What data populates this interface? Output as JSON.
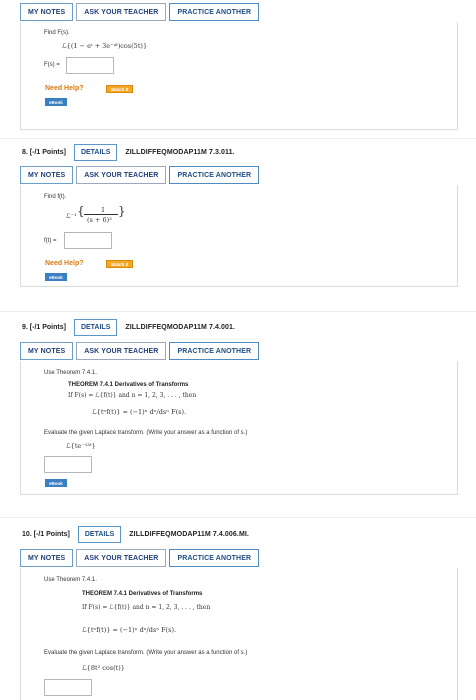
{
  "buttons": {
    "my_notes": "MY NOTES",
    "ask_teacher": "ASK YOUR TEACHER",
    "practice": "PRACTICE ANOTHER",
    "details": "DETAILS"
  },
  "help": {
    "need_help": "Need Help?",
    "watch": "Watch It",
    "ebook": "eBook"
  },
  "q7": {
    "instruction": "Find F(s).",
    "expression": "ℒ{(1 − eᵗ + 3e⁻⁴ᵗ)cos(5t)}",
    "answer_label": "F(s) ="
  },
  "q8": {
    "number": "8. [-/1 Points]",
    "id": "ZILLDIFFEQMODAP11M 7.3.011.",
    "instruction": "Find f(t).",
    "op": "ℒ⁻¹",
    "numerator": "1",
    "denominator": "(s + 6)³",
    "answer_label": "f(t) ="
  },
  "q9": {
    "number": "9. [-/1 Points]",
    "id": "ZILLDIFFEQMODAP11M 7.4.001.",
    "use": "Use Theorem 7.4.1.",
    "theorem_title": "THEOREM 7.4.1  Derivatives of Transforms",
    "theorem_line": "If F(s) = ℒ{f(t)} and n = 1, 2, 3, . . . , then",
    "formula": "ℒ{tⁿf(t)} = (−1)ⁿ dⁿ/dsⁿ F(s).",
    "evaluate": "Evaluate the given Laplace transform. (Write your answer as a function of s.)",
    "expression": "ℒ{te⁻¹³ᵗ}"
  },
  "q10": {
    "number": "10. [-/1 Points]",
    "id": "ZILLDIFFEQMODAP11M 7.4.006.MI.",
    "use": "Use Theorem 7.4.1.",
    "theorem_title": "THEOREM 7.4.1  Derivatives of Transforms",
    "theorem_line": "If F(s) = ℒ{f(t)} and n = 1, 2, 3, . . . , then",
    "formula": "ℒ{tⁿf(t)} = (−1)ⁿ dⁿ/dsⁿ F(s).",
    "evaluate": "Evaluate the given Laplace transform. (Write your answer as a function of s.)",
    "expression": "ℒ{8t² cos(t)}"
  }
}
